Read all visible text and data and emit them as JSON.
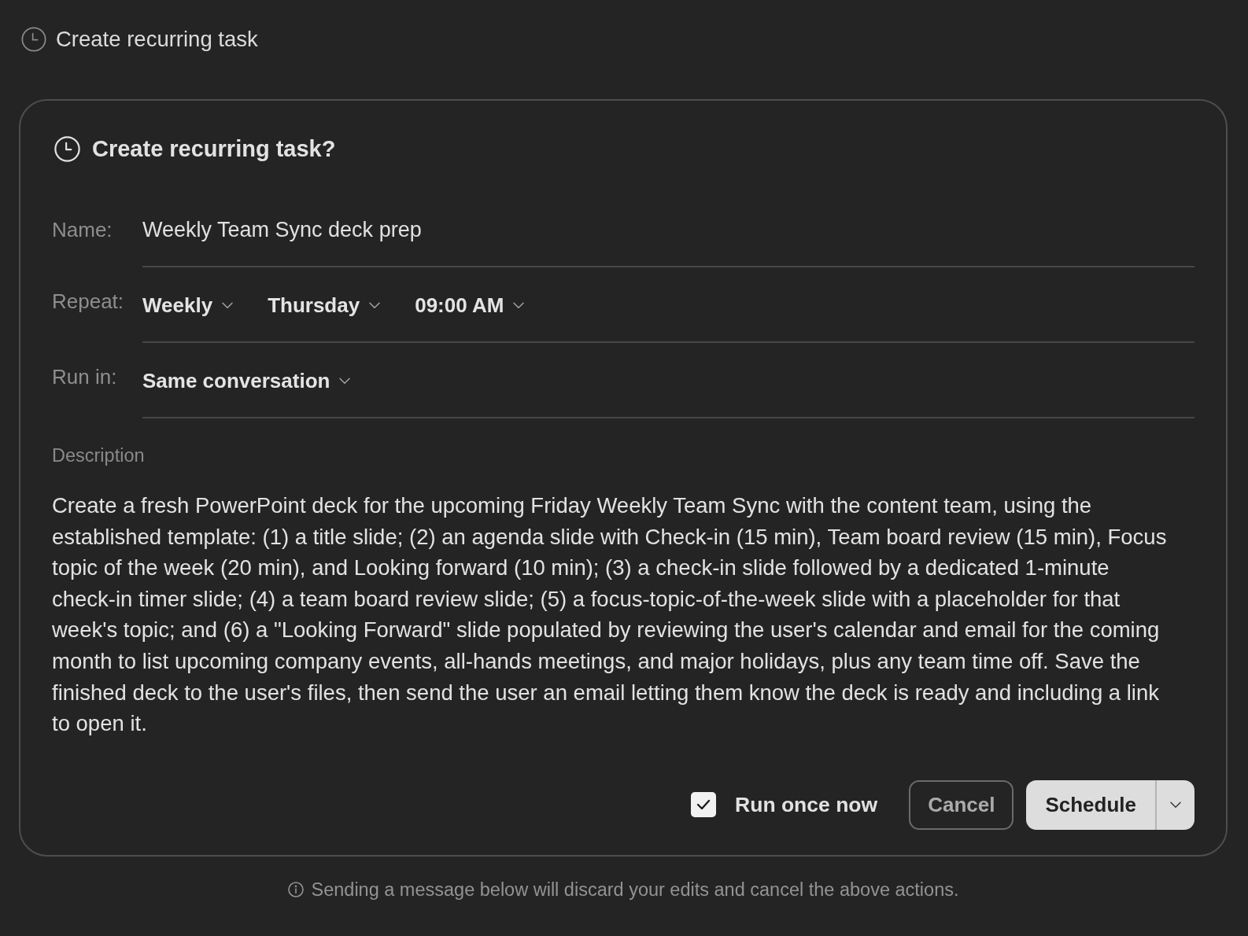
{
  "header": {
    "title": "Create recurring task"
  },
  "card": {
    "title": "Create recurring task?",
    "fields": [
      {
        "kind": "text",
        "label": "Name:",
        "value": "Weekly Team Sync deck prep"
      },
      {
        "kind": "dropdowns",
        "label": "Repeat:",
        "options": [
          "Weekly",
          "Thursday",
          "09:00 AM"
        ]
      },
      {
        "kind": "dropdowns",
        "label": "Run in:",
        "options": [
          "Same conversation"
        ]
      }
    ],
    "description": {
      "label": "Description",
      "text": "Create a fresh PowerPoint deck for the upcoming Friday Weekly Team Sync with the content team, using the established template: (1) a title slide; (2) an agenda slide with Check-in (15 min), Team board review (15 min), Focus topic of the week (20 min), and Looking forward (10 min); (3) a check-in slide followed by a dedicated 1-minute check-in timer slide; (4) a team board review slide; (5) a focus-topic-of-the-week slide with a placeholder for that week's topic; and (6) a \"Looking Forward\" slide populated by reviewing the user's calendar and email for the coming month to list upcoming company events, all-hands meetings, and major holidays, plus any team time off. Save the finished deck to the user's files, then send the user an email letting them know the deck is ready and including a link to open it."
    },
    "run_once_now": {
      "label": "Run once now",
      "checked": true
    },
    "buttons": [
      {
        "kind": "secondary",
        "label": "Cancel"
      },
      {
        "kind": "split",
        "label": "Schedule"
      }
    ]
  },
  "footer_note": "Sending a message below will discard your edits and cancel the above actions."
}
